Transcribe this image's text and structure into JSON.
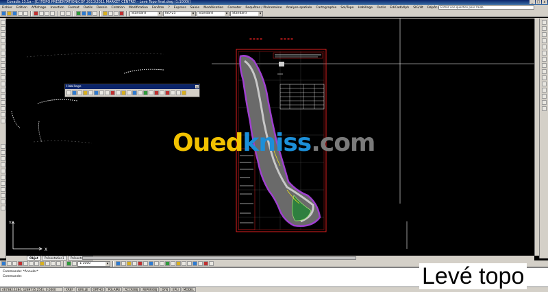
{
  "window": {
    "title": "Covadis 13.1a - [C:\\TOPO PRESENTATION\\COF 2011\\2011 MARKET CENTRE\\ - Levé Topo final.dwg (1:1000)]"
  },
  "menu": [
    "Fichier",
    "Edition",
    "Affichage",
    "Insertion",
    "Format",
    "Outils",
    "Dessin",
    "Cotation",
    "Modification",
    "Fenêtre",
    "?",
    "Express",
    "Saisie",
    "Modélisation",
    "Cornoter",
    "Requêtes / Phénomène",
    "Analyse spatiale",
    "Cartographie",
    "Sol/Topo",
    "Habillage",
    "Outils",
    "EdiCad/Alph",
    "SIG/Ht",
    "Dépôt cadastre"
  ],
  "help_placeholder": "Entrez une question pour l'aide",
  "toolbar2": {
    "style1": "Standard",
    "style2": "ISO-25",
    "style3": "Standard",
    "style4": "Standard"
  },
  "toolbar3": {
    "layer": "0",
    "color": "DuCalque",
    "linetype": "DuCalque",
    "lineweight": "DuCalque",
    "plotstyle": "DuCouleur",
    "layout": "Calques"
  },
  "float_toolbar": {
    "title": "Habillage",
    "close": "x"
  },
  "tabs": [
    "Objet",
    "Présentation1",
    "Présentation2"
  ],
  "active_tab": "Objet",
  "toolbar_bottom": {
    "scale": "1:1000"
  },
  "command_lines": [
    "Commande: *Annuler*",
    "Commande:"
  ],
  "status": [
    "XREF",
    "GRILLE",
    "ORTHO",
    "POLAIRE",
    "ACCROBJ",
    "REPEROBJ",
    "DYN",
    "EPLI",
    "MODEL"
  ],
  "coords": "467382.1284, 1289715.2541, 0.0000",
  "watermark": {
    "part1": "Oued",
    "part2": "kniss",
    "part3": ".com"
  },
  "overlay_text": "Levé topo"
}
